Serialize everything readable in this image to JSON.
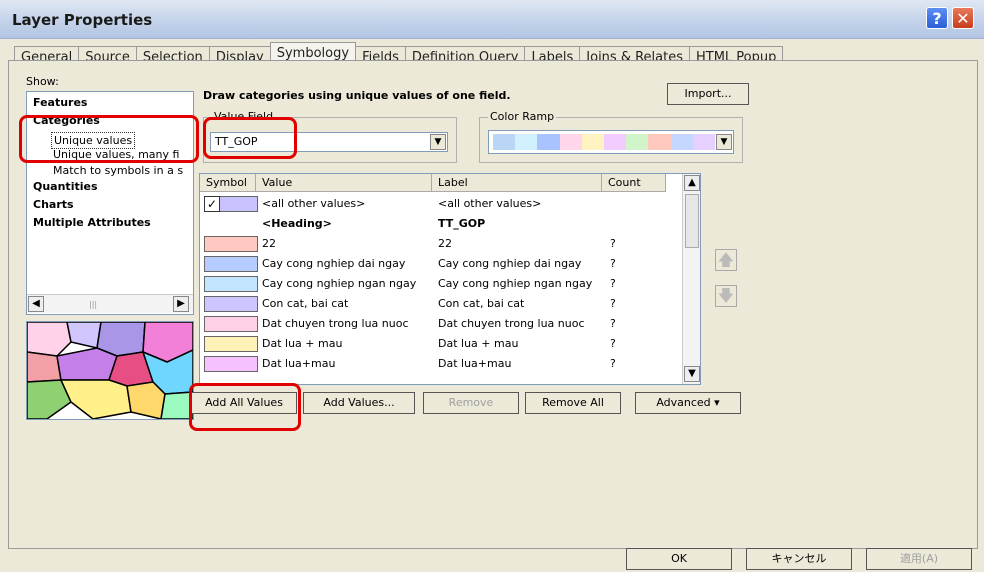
{
  "window": {
    "title": "Layer Properties"
  },
  "tabs": [
    "General",
    "Source",
    "Selection",
    "Display",
    "Symbology",
    "Fields",
    "Definition Query",
    "Labels",
    "Joins & Relates",
    "HTML Popup"
  ],
  "active_tab": "Symbology",
  "show": {
    "label": "Show:",
    "items": [
      "Features",
      "Categories",
      "Unique values",
      "Unique values, many fi",
      "Match to symbols in a s",
      "Quantities",
      "Charts",
      "Multiple Attributes"
    ]
  },
  "symbology": {
    "description": "Draw categories using unique values of one field.",
    "import_label": "Import...",
    "value_field_label": "Value Field",
    "value_field_value": "TT_GOP",
    "color_ramp_label": "Color Ramp",
    "color_ramp_colors": [
      "#b9d7f4",
      "#d2f1ff",
      "#a9c3ff",
      "#ffd6ea",
      "#fff3c2",
      "#f2cbff",
      "#d1f5c8",
      "#ffc8bf",
      "#c6d7ff",
      "#e5d0ff"
    ]
  },
  "table": {
    "headers": [
      "Symbol",
      "Value",
      "Label",
      "Count"
    ],
    "rows": [
      {
        "checked": true,
        "color": "#c8c3ff",
        "value": "<all other values>",
        "label": "<all other values>",
        "count": "",
        "bold": false
      },
      {
        "checked": false,
        "color": "",
        "value": "<Heading>",
        "label": "TT_GOP",
        "count": "",
        "bold": true
      },
      {
        "checked": false,
        "color": "#ffc8c0",
        "value": "22",
        "label": "22",
        "count": "?",
        "bold": false
      },
      {
        "checked": false,
        "color": "#b6cbff",
        "value": "Cay cong nghiep dai ngay",
        "label": "Cay cong nghiep dai ngay",
        "count": "?",
        "bold": false
      },
      {
        "checked": false,
        "color": "#c3e5ff",
        "value": "Cay cong nghiep ngan ngay",
        "label": "Cay cong nghiep ngan ngay",
        "count": "?",
        "bold": false
      },
      {
        "checked": false,
        "color": "#cdc5ff",
        "value": "Con cat, bai cat",
        "label": "Con cat, bai cat",
        "count": "?",
        "bold": false
      },
      {
        "checked": false,
        "color": "#ffd0e6",
        "value": "Dat chuyen trong lua nuoc",
        "label": "Dat chuyen trong lua nuoc",
        "count": "?",
        "bold": false
      },
      {
        "checked": false,
        "color": "#fff2b8",
        "value": "Dat lua + mau",
        "label": "Dat lua + mau",
        "count": "?",
        "bold": false
      },
      {
        "checked": false,
        "color": "#f6c1ff",
        "value": "Dat lua+mau",
        "label": "Dat lua+mau",
        "count": "?",
        "bold": false
      }
    ]
  },
  "buttons": {
    "add_all": "Add All Values",
    "add_values": "Add Values...",
    "remove": "Remove",
    "remove_all": "Remove All",
    "advanced": "Advanced",
    "ok": "OK",
    "cancel": "キャンセル",
    "apply": "適用(A)"
  },
  "icons": {
    "help": "question-icon",
    "close": "close-icon",
    "move_up": "arrow-up-icon",
    "move_down": "arrow-down-icon"
  }
}
